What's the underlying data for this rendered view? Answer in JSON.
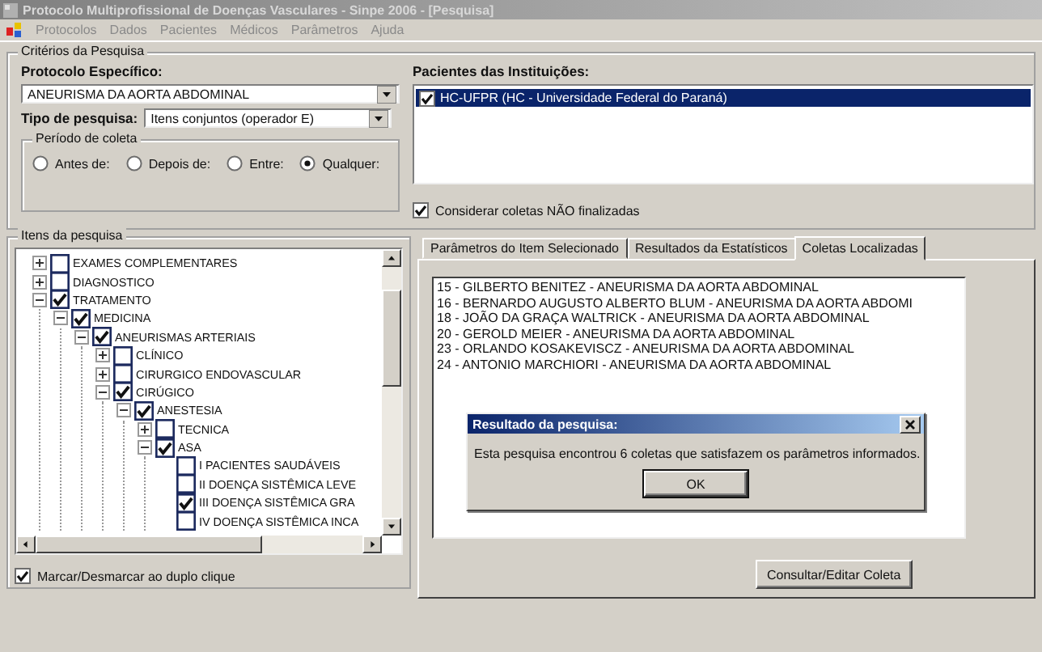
{
  "window": {
    "title": "Protocolo Multiprofissional de Doenças Vasculares - Sinpe 2006 - [Pesquisa]"
  },
  "menu": [
    {
      "label": "Protocolos",
      "disabled": true
    },
    {
      "label": "Dados",
      "disabled": true
    },
    {
      "label": "Pacientes",
      "disabled": true
    },
    {
      "label": "Médicos",
      "disabled": true
    },
    {
      "label": "Parâmetros",
      "disabled": true
    },
    {
      "label": "Ajuda",
      "disabled": true
    }
  ],
  "criteria": {
    "title": "Critérios da Pesquisa",
    "protocol_label": "Protocolo Específico:",
    "protocol_value": "ANEURISMA DA AORTA ABDOMINAL",
    "search_type_label": "Tipo de pesquisa:",
    "search_type_value": "Itens conjuntos (operador E)",
    "period": {
      "title": "Período de coleta",
      "options": [
        {
          "label": "Antes de:",
          "selected": false
        },
        {
          "label": "Depois de:",
          "selected": false
        },
        {
          "label": "Entre:",
          "selected": false
        },
        {
          "label": "Qualquer:",
          "selected": true
        }
      ]
    },
    "institutions": {
      "title": "Pacientes das Instituições:",
      "items": [
        {
          "label": "HC-UFPR (HC - Universidade Federal do Paraná)",
          "checked": true,
          "selected": true
        }
      ]
    },
    "unfinished": {
      "label": "Considerar coletas NÃO finalizadas",
      "checked": true
    }
  },
  "items": {
    "title": "Itens da pesquisa",
    "tree": [
      {
        "label": "EXAMES COMPLEMENTARES",
        "checked": false,
        "expanded": false
      },
      {
        "label": "DIAGNOSTICO",
        "checked": false,
        "expanded": false
      },
      {
        "label": "TRATAMENTO",
        "checked": true,
        "expanded": true,
        "children": [
          {
            "label": "MEDICINA",
            "checked": true,
            "expanded": true,
            "children": [
              {
                "label": "ANEURISMAS ARTERIAIS",
                "checked": true,
                "expanded": true,
                "children": [
                  {
                    "label": "CLÍNICO",
                    "checked": false,
                    "expanded": false
                  },
                  {
                    "label": "CIRURGICO ENDOVASCULAR",
                    "checked": false,
                    "expanded": false
                  },
                  {
                    "label": "CIRÚGICO",
                    "checked": true,
                    "expanded": true,
                    "children": [
                      {
                        "label": "ANESTESIA",
                        "checked": true,
                        "expanded": true,
                        "children": [
                          {
                            "label": "TECNICA",
                            "checked": false,
                            "expanded": false
                          },
                          {
                            "label": "ASA",
                            "checked": true,
                            "expanded": true,
                            "children": [
                              {
                                "label": "I PACIENTES SAUDÁVEIS",
                                "checked": false
                              },
                              {
                                "label": "II DOENÇA SISTÊMICA LEVE",
                                "checked": false
                              },
                              {
                                "label": "III DOENÇA SISTÊMICA GRA",
                                "checked": true
                              },
                              {
                                "label": "IV DOENÇA SISTÊMICA INCA",
                                "checked": false
                              }
                            ]
                          }
                        ]
                      }
                    ]
                  }
                ]
              }
            ]
          }
        ]
      }
    ],
    "double_click": {
      "label": "Marcar/Desmarcar ao duplo clique",
      "checked": true
    }
  },
  "results": {
    "tabs": [
      {
        "label": "Parâmetros do Item Selecionado",
        "selected": false
      },
      {
        "label": "Resultados da Estatísticos",
        "selected": false
      },
      {
        "label": "Coletas Localizadas",
        "selected": true
      }
    ],
    "list": [
      "15 - GILBERTO BENITEZ - ANEURISMA DA AORTA ABDOMINAL",
      "16 - BERNARDO AUGUSTO ALBERTO BLUM - ANEURISMA DA AORTA ABDOMI",
      "18 - JOÃO DA GRAÇA WALTRICK - ANEURISMA DA AORTA ABDOMINAL",
      "20 - GEROLD MEIER - ANEURISMA DA AORTA ABDOMINAL",
      "23 - ORLANDO KOSAKEVISCZ - ANEURISMA DA AORTA ABDOMINAL",
      "24 - ANTONIO MARCHIORI - ANEURISMA DA AORTA ABDOMINAL"
    ],
    "button": "Consultar/Editar Coleta"
  },
  "dialog": {
    "title": "Resultado da pesquisa:",
    "message": "Esta pesquisa encontrou 6 coletas que satisfazem os parâmetros informados.",
    "button": "OK"
  }
}
